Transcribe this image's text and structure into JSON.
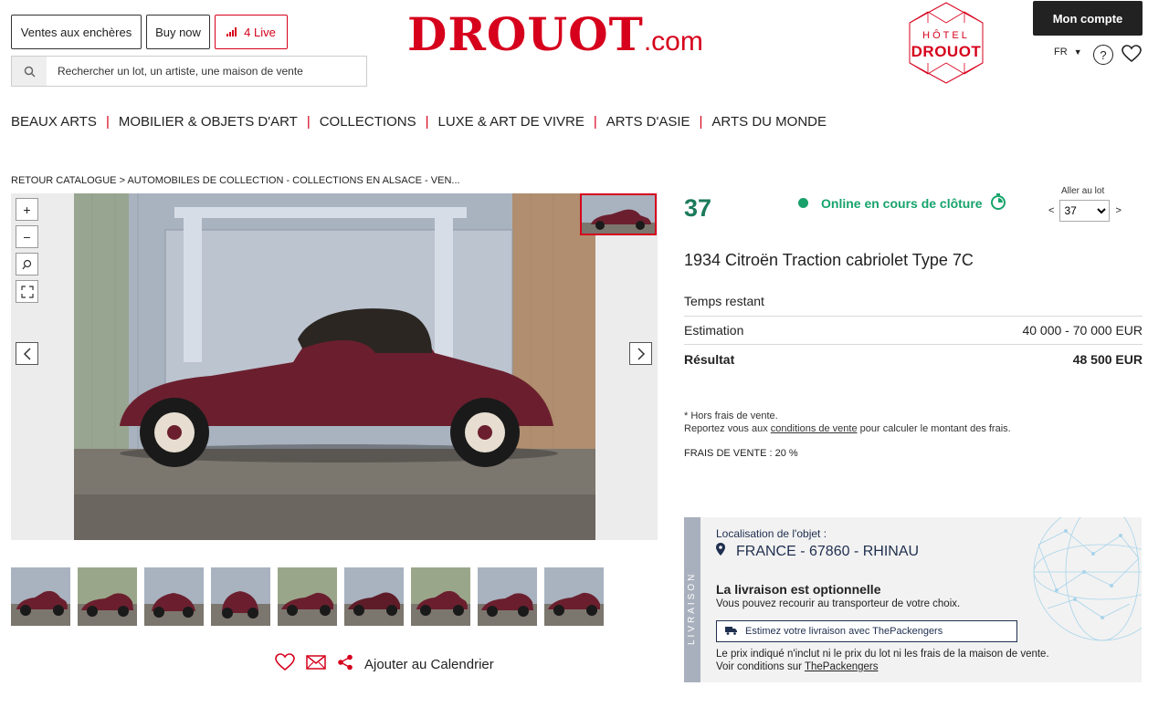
{
  "header": {
    "auctions_label": "Ventes aux enchères",
    "buynow_label": "Buy now",
    "live_label": "4 Live",
    "search_placeholder": "Rechercher un lot, un artiste, une maison de vente",
    "logo_main": "DROUOT",
    "logo_suffix": ".com",
    "hotel_line1": "HÔTEL",
    "hotel_line2": "DROUOT",
    "account_label": "Mon compte",
    "language": "FR"
  },
  "nav": [
    "BEAUX ARTS",
    "MOBILIER & OBJETS D'ART",
    "COLLECTIONS",
    "LUXE & ART DE VIVRE",
    "ARTS D'ASIE",
    "ARTS DU MONDE"
  ],
  "breadcrumb": "RETOUR CATALOGUE > AUTOMOBILES DE COLLECTION - COLLECTIONS EN ALSACE - VEN...",
  "actions": {
    "calendar_label": "Ajouter au Calendrier"
  },
  "lot": {
    "number": "37",
    "status": "Online en cours de clôture",
    "goto_label": "Aller au lot",
    "goto_value": "37",
    "title": "1934 Citroën Traction cabriolet Type 7C",
    "time_left_label": "Temps restant",
    "estimate_label": "Estimation",
    "estimate_value": "40 000 - 70 000 EUR",
    "result_label": "Résultat",
    "result_value": "48 500 EUR",
    "note_line1": "* Hors frais de vente.",
    "note_line2_pre": "Reportez vous aux ",
    "note_link": "conditions de vente",
    "note_line2_post": " pour calculer le montant des frais.",
    "fees": "FRAIS DE VENTE : 20 %"
  },
  "delivery": {
    "side_label": "LIVRAISON",
    "location_label": "Localisation de l'objet :",
    "location_value": "FRANCE - 67860 - RHINAU",
    "optional_title": "La livraison est optionnelle",
    "optional_text": "Vous pouvez recourir au transporteur de votre choix.",
    "estimate_button": "Estimez votre livraison avec ThePackengers",
    "disclaimer_line1": "Le prix indiqué n'inclut ni le prix du lot ni les frais de la maison de vente.",
    "disclaimer_line2_pre": "Voir conditions sur ",
    "disclaimer_link": "ThePackengers"
  },
  "colors": {
    "brand_red": "#d6001c",
    "lot_green": "#1b7b5a",
    "status_green": "#17a36b",
    "navy": "#1f2f4f"
  },
  "icons": [
    "search-icon",
    "signal-icon",
    "help-icon",
    "heart-icon",
    "zoom-in-icon",
    "zoom-out-icon",
    "magnifier-icon",
    "fullscreen-icon",
    "chevron-left-icon",
    "chevron-right-icon",
    "mail-icon",
    "share-icon",
    "stopwatch-icon",
    "map-pin-icon",
    "truck-icon"
  ]
}
